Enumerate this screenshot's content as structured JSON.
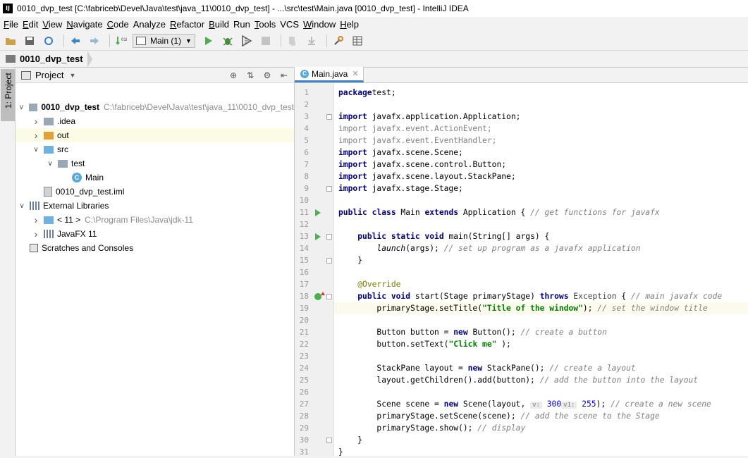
{
  "window": {
    "title": "0010_dvp_test [C:\\fabriceb\\Devel\\Java\\test\\java_11\\0010_dvp_test] - ...\\src\\test\\Main.java [0010_dvp_test] - IntelliJ IDEA",
    "app_logo": "IJ"
  },
  "menu": [
    {
      "m": "F",
      "rest": "ile"
    },
    {
      "m": "E",
      "rest": "dit"
    },
    {
      "m": "V",
      "rest": "iew"
    },
    {
      "m": "N",
      "rest": "avigate"
    },
    {
      "m": "C",
      "rest": "ode"
    },
    {
      "m": "",
      "rest": "Analyze"
    },
    {
      "m": "R",
      "rest": "efactor"
    },
    {
      "m": "B",
      "rest": "uild"
    },
    {
      "m": "",
      "rest": "Run"
    },
    {
      "m": "T",
      "rest": "ools"
    },
    {
      "m": "",
      "rest": "VCS"
    },
    {
      "m": "W",
      "rest": "indow"
    },
    {
      "m": "H",
      "rest": "elp"
    }
  ],
  "toolbar": {
    "run_config": "Main (1)"
  },
  "navbar": {
    "project": "0010_dvp_test"
  },
  "side_strip": {
    "label": "1: Project"
  },
  "project_panel": {
    "title": "Project",
    "tree": [
      {
        "label": "0010_dvp_test",
        "path": "C:\\fabriceb\\Devel\\Java\\test\\java_11\\0010_dvp_test",
        "icon": "folder",
        "arrow": "open",
        "indent": 0,
        "bold": true
      },
      {
        "label": ".idea",
        "path": "",
        "icon": "folder",
        "arrow": "closed",
        "indent": 1
      },
      {
        "label": "out",
        "path": "",
        "icon": "folder-orange",
        "arrow": "closed",
        "indent": 1,
        "selected": true
      },
      {
        "label": "src",
        "path": "",
        "icon": "folder-blue",
        "arrow": "open",
        "indent": 1
      },
      {
        "label": "test",
        "path": "",
        "icon": "package",
        "arrow": "open",
        "indent": 2
      },
      {
        "label": "Main",
        "path": "",
        "icon": "class",
        "arrow": "none",
        "indent": 3
      },
      {
        "label": "0010_dvp_test.iml",
        "path": "",
        "icon": "file",
        "arrow": "none",
        "indent": 1
      },
      {
        "label": "External Libraries",
        "path": "",
        "icon": "library",
        "arrow": "open",
        "indent": 0
      },
      {
        "label": "< 11 >",
        "path": "C:\\Program Files\\Java\\jdk-11",
        "icon": "jdk",
        "arrow": "closed",
        "indent": 1
      },
      {
        "label": "JavaFX 11",
        "path": "",
        "icon": "library",
        "arrow": "closed",
        "indent": 1
      },
      {
        "label": "Scratches and Consoles",
        "path": "",
        "icon": "scratch",
        "arrow": "none",
        "indent": 0
      }
    ]
  },
  "editor": {
    "tab_label": "Main.java",
    "current_line": 19,
    "lines": [
      {
        "n": 1,
        "tokens": [
          [
            "kw",
            "package"
          ],
          [
            "",
            "test;"
          ]
        ]
      },
      {
        "n": 2,
        "tokens": []
      },
      {
        "n": 3,
        "tokens": [
          [
            "kw",
            "import"
          ],
          [
            "",
            " javafx.application.Application;"
          ]
        ]
      },
      {
        "n": 4,
        "tokens": [
          [
            "unused",
            "import javafx.event.ActionEvent;"
          ]
        ]
      },
      {
        "n": 5,
        "tokens": [
          [
            "unused",
            "import javafx.event.EventHandler;"
          ]
        ]
      },
      {
        "n": 6,
        "tokens": [
          [
            "kw",
            "import"
          ],
          [
            "",
            " javafx.scene.Scene;"
          ]
        ]
      },
      {
        "n": 7,
        "tokens": [
          [
            "kw",
            "import"
          ],
          [
            "",
            " javafx.scene.control.Button;"
          ]
        ]
      },
      {
        "n": 8,
        "tokens": [
          [
            "kw",
            "import"
          ],
          [
            "",
            " javafx.scene.layout.StackPane;"
          ]
        ]
      },
      {
        "n": 9,
        "tokens": [
          [
            "kw",
            "import"
          ],
          [
            "",
            " javafx.stage.Stage;"
          ]
        ]
      },
      {
        "n": 10,
        "tokens": []
      },
      {
        "n": 11,
        "tokens": [
          [
            "kw",
            "public class"
          ],
          [
            "",
            " Main "
          ],
          [
            "kw",
            "extends"
          ],
          [
            "",
            " Application { "
          ],
          [
            "cm",
            "// get functions for javafx"
          ]
        ]
      },
      {
        "n": 12,
        "tokens": []
      },
      {
        "n": 13,
        "tokens": [
          [
            "",
            "    "
          ],
          [
            "kw",
            "public static void"
          ],
          [
            "",
            " main(String[] args) {"
          ]
        ]
      },
      {
        "n": 14,
        "tokens": [
          [
            "",
            "        "
          ],
          [
            "ital",
            "launch"
          ],
          [
            "",
            "(args); "
          ],
          [
            "cm",
            "// set up program as a javafx application"
          ]
        ]
      },
      {
        "n": 15,
        "tokens": [
          [
            "",
            "    }"
          ]
        ]
      },
      {
        "n": 16,
        "tokens": []
      },
      {
        "n": 17,
        "tokens": [
          [
            "",
            "    "
          ],
          [
            "an",
            "@Override"
          ]
        ]
      },
      {
        "n": 18,
        "tokens": [
          [
            "",
            "    "
          ],
          [
            "kw",
            "public void"
          ],
          [
            "",
            " start(Stage primaryStage) "
          ],
          [
            "kw",
            "throws"
          ],
          [
            "exc",
            " Exception"
          ],
          [
            "",
            " { "
          ],
          [
            "cm",
            "// main javafx code"
          ]
        ]
      },
      {
        "n": 19,
        "tokens": [
          [
            "",
            "        primaryStage.setTitle("
          ],
          [
            "st",
            "\"Title of the window\""
          ],
          [
            "",
            "); "
          ],
          [
            "cm",
            "// set the window title"
          ]
        ]
      },
      {
        "n": 20,
        "tokens": []
      },
      {
        "n": 21,
        "tokens": [
          [
            "",
            "        Button button = "
          ],
          [
            "kw",
            "new"
          ],
          [
            "",
            " Button(); "
          ],
          [
            "cm",
            "// create a button"
          ]
        ]
      },
      {
        "n": 22,
        "tokens": [
          [
            "",
            "        button.setText("
          ],
          [
            "st",
            "\"Click me\""
          ],
          [
            "",
            " );"
          ]
        ]
      },
      {
        "n": 23,
        "tokens": []
      },
      {
        "n": 24,
        "tokens": [
          [
            "",
            "        StackPane layout = "
          ],
          [
            "kw",
            "new"
          ],
          [
            "",
            " StackPane(); "
          ],
          [
            "cm",
            "// create a layout"
          ]
        ]
      },
      {
        "n": 25,
        "tokens": [
          [
            "",
            "        layout.getChildren().add(button); "
          ],
          [
            "cm",
            "// add the button into the layout"
          ]
        ]
      },
      {
        "n": 26,
        "tokens": []
      },
      {
        "n": 27,
        "tokens": [
          [
            "",
            "        Scene scene = "
          ],
          [
            "kw",
            "new"
          ],
          [
            "",
            " Scene(layout, "
          ],
          [
            "hint",
            "v:"
          ],
          [
            "num",
            " 300"
          ],
          [
            ", "
          ],
          [
            "hint",
            "v1:"
          ],
          [
            "num",
            " 255"
          ],
          [
            "",
            "); "
          ],
          [
            "cm",
            "// create a new scene"
          ]
        ]
      },
      {
        "n": 28,
        "tokens": [
          [
            "",
            "        primaryStage.setScene(scene); "
          ],
          [
            "cm",
            "// add the scene to the Stage"
          ]
        ]
      },
      {
        "n": 29,
        "tokens": [
          [
            "",
            "        primaryStage.show(); "
          ],
          [
            "cm",
            "// display"
          ]
        ]
      },
      {
        "n": 30,
        "tokens": [
          [
            "",
            "    }"
          ]
        ]
      },
      {
        "n": 31,
        "tokens": [
          [
            "",
            "}"
          ]
        ]
      }
    ],
    "gutter_marks": [
      {
        "line": 11,
        "kind": "run"
      },
      {
        "line": 13,
        "kind": "run"
      },
      {
        "line": 18,
        "kind": "override"
      }
    ],
    "fold_marks": [
      3,
      9,
      13,
      15,
      18,
      30
    ]
  }
}
